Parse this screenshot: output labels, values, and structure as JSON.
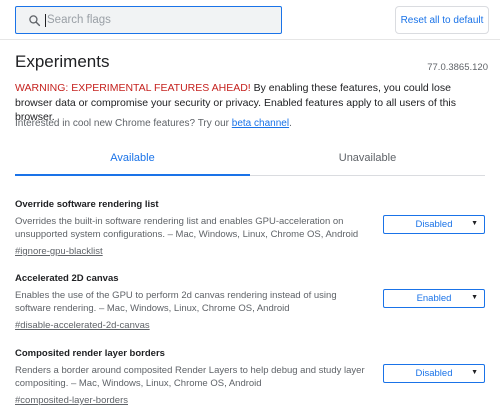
{
  "header": {
    "search_placeholder": "Search flags",
    "reset_label": "Reset all to default"
  },
  "page": {
    "title": "Experiments",
    "version": "77.0.3865.120",
    "warning_strong": "WARNING: EXPERIMENTAL FEATURES AHEAD!",
    "warning_rest": " By enabling these features, you could lose browser data or compromise your security or privacy. Enabled features apply to all users of this browser.",
    "channel_prefix": "Interested in cool new Chrome features? Try our ",
    "channel_link": "beta channel",
    "channel_suffix": "."
  },
  "tabs": [
    {
      "label": "Available",
      "active": true
    },
    {
      "label": "Unavailable",
      "active": false
    }
  ],
  "experiments": [
    {
      "name": "Override software rendering list",
      "description": "Overrides the built-in software rendering list and enables GPU-acceleration on unsupported system configurations. – Mac, Windows, Linux, Chrome OS, Android",
      "link": "#ignore-gpu-blacklist",
      "value": "Disabled"
    },
    {
      "name": "Accelerated 2D canvas",
      "description": "Enables the use of the GPU to perform 2d canvas rendering instead of using software rendering. – Mac, Windows, Linux, Chrome OS, Android",
      "link": "#disable-accelerated-2d-canvas",
      "value": "Enabled"
    },
    {
      "name": "Composited render layer borders",
      "description": "Renders a border around composited Render Layers to help debug and study layer compositing. – Mac, Windows, Linux, Chrome OS, Android",
      "link": "#composited-layer-borders",
      "value": "Disabled"
    }
  ],
  "colors": {
    "accent": "#1a73e8",
    "warning": "#c5221f"
  },
  "icons": {
    "search": "search-icon",
    "dropdown": "dropdown-arrow-icon"
  }
}
